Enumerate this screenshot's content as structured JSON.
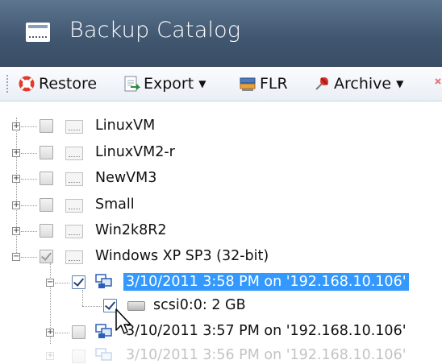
{
  "window": {
    "title": "Backup Catalog"
  },
  "toolbar": {
    "restore": "Restore",
    "export": "Export",
    "flr": "FLR",
    "archive": "Archive"
  },
  "tree": {
    "vms": [
      {
        "label": "LinuxVM",
        "checked": false
      },
      {
        "label": "LinuxVM2-r",
        "checked": false
      },
      {
        "label": "NewVM3",
        "checked": false
      },
      {
        "label": "Small",
        "checked": false
      },
      {
        "label": "Win2k8R2",
        "checked": false
      },
      {
        "label": "Windows XP SP3 (32-bit)",
        "checked": "partial",
        "expanded": true
      }
    ],
    "snapshot_1": {
      "label": "3/10/2011 3:58 PM on '192.168.10.106'",
      "checked": true,
      "selected": true
    },
    "disk_1": {
      "label": "scsi0:0: 2 GB",
      "checked": true
    },
    "snapshot_2": {
      "label": "3/10/2011 3:57 PM on '192.168.10.106'",
      "checked": false
    },
    "snapshot_3": {
      "label": "3/10/2011 3:56 PM on '192.168.10.106'",
      "checked": false
    }
  },
  "colors": {
    "titlebar": "#40566f",
    "selection": "#3399ff",
    "check": "#2a3f7a"
  },
  "icons": [
    "window-icon",
    "restore-icon",
    "export-icon",
    "flr-icon",
    "archive-icon",
    "vm-icon",
    "snapshot-icon",
    "disk-icon",
    "cursor-icon"
  ]
}
